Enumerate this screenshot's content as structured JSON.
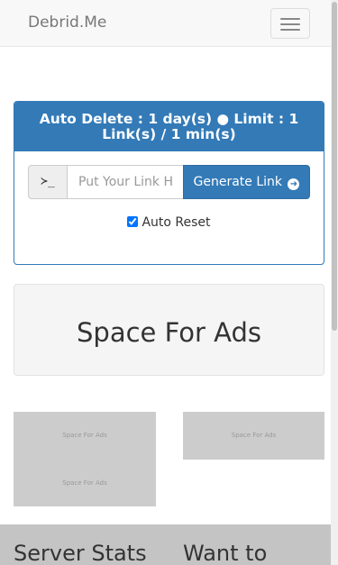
{
  "navbar": {
    "brand": "Debrid.Me",
    "menu_icon": "hamburger-icon"
  },
  "panel": {
    "heading": "Auto Delete : 1 day(s) ● Limit : 1 Link(s) / 1 min(s)",
    "addon_icon": "terminal-icon",
    "addon_text": "≻_",
    "input_placeholder": "Put Your Link Here",
    "input_value": "",
    "generate_label": "Generate Link",
    "generate_icon": "arrow-circle-right-icon",
    "auto_reset_label": "Auto Reset",
    "auto_reset_checked": true,
    "accent_color": "#337ab7"
  },
  "ads": {
    "banner_text": "Space For Ads",
    "small_text": "Space For Ads"
  },
  "footer": {
    "left_heading": "Server Stats",
    "right_heading": "Want to"
  }
}
